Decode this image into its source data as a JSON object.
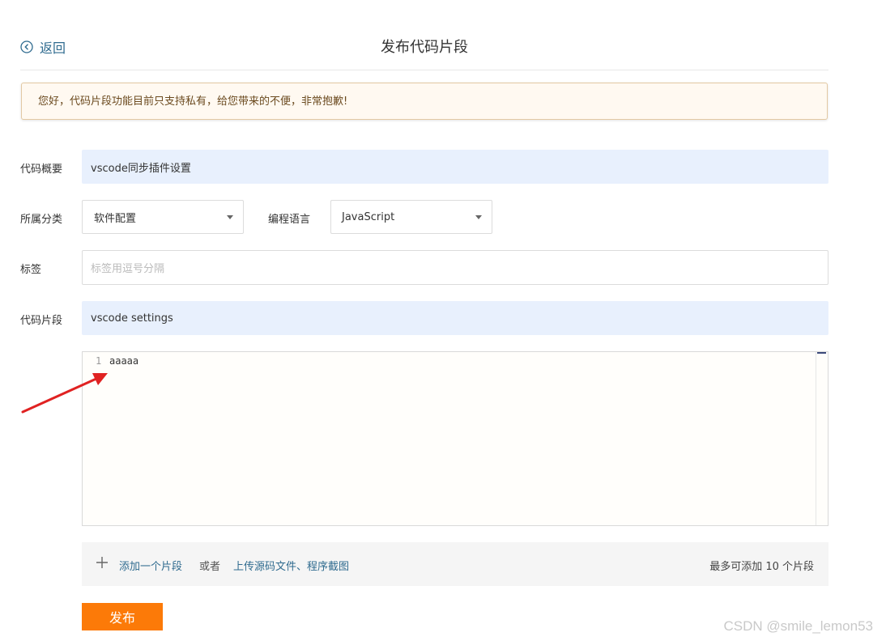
{
  "header": {
    "back_label": "返回",
    "title": "发布代码片段"
  },
  "notice": {
    "text": "您好，代码片段功能目前只支持私有，给您带来的不便，非常抱歉!"
  },
  "form": {
    "summary_label": "代码概要",
    "summary_value": "vscode同步插件设置",
    "category_label": "所属分类",
    "category_value": "软件配置",
    "language_label": "编程语言",
    "language_value": "JavaScript",
    "tags_label": "标签",
    "tags_placeholder": "标签用逗号分隔",
    "snippet_label": "代码片段",
    "snippet_title_value": "vscode settings"
  },
  "editor": {
    "line_number": "1",
    "code": "aaaaa"
  },
  "snippet_bar": {
    "add_label": "添加一个片段",
    "or_label": "或者",
    "upload_label": "上传源码文件、程序截图",
    "limit_label": "最多可添加 10 个片段"
  },
  "actions": {
    "publish_label": "发布"
  },
  "watermark": {
    "text": "CSDN @smile_lemon53"
  },
  "colors": {
    "accent": "#fc7a08",
    "link": "#2f6b8f",
    "annotation_arrow": "#e02222"
  },
  "icons": {
    "back": "circle-chevron-left-icon",
    "plus": "plus-icon",
    "dropdown": "caret-down-icon"
  }
}
